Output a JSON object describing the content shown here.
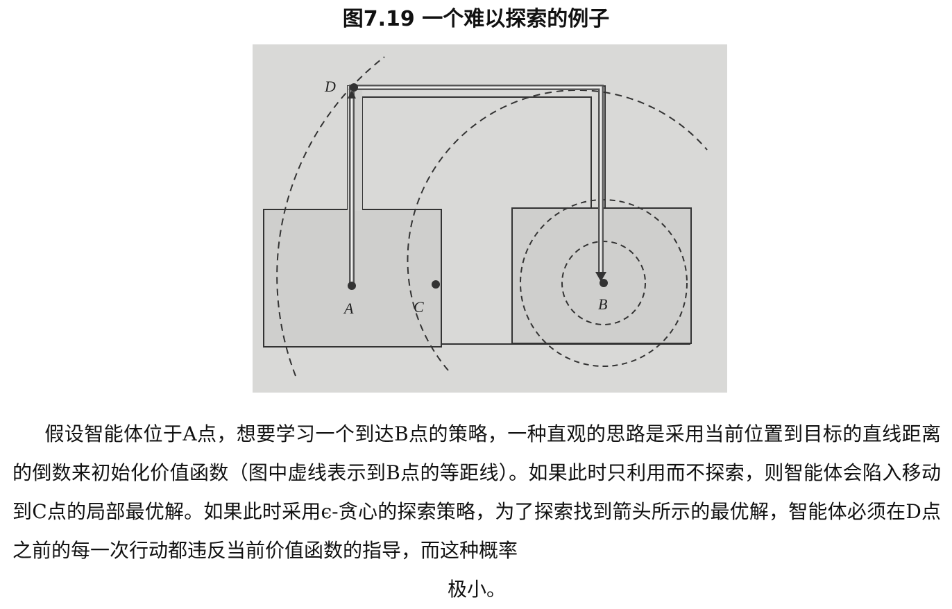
{
  "caption": "图7.19 一个难以探索的例子",
  "figure": {
    "labels": {
      "a": "A",
      "b": "B",
      "c": "C",
      "d": "D"
    }
  },
  "paragraph": {
    "body": "假设智能体位于A点，想要学习一个到达B点的策略，一种直观的思路是采用当前位置到目标的直线距离的倒数来初始化价值函数（图中虚线表示到B点的等距线）。如果此时只利用而不探索，则智能体会陷入移动到C点的局部最优解。如果此时采用ϵ-贪心的探索策略，为了探索找到箭头所示的最优解，智能体必须在D点之前的每一次行动都违反当前价值函数的指导，而这种概率",
    "tail": "极小。"
  }
}
